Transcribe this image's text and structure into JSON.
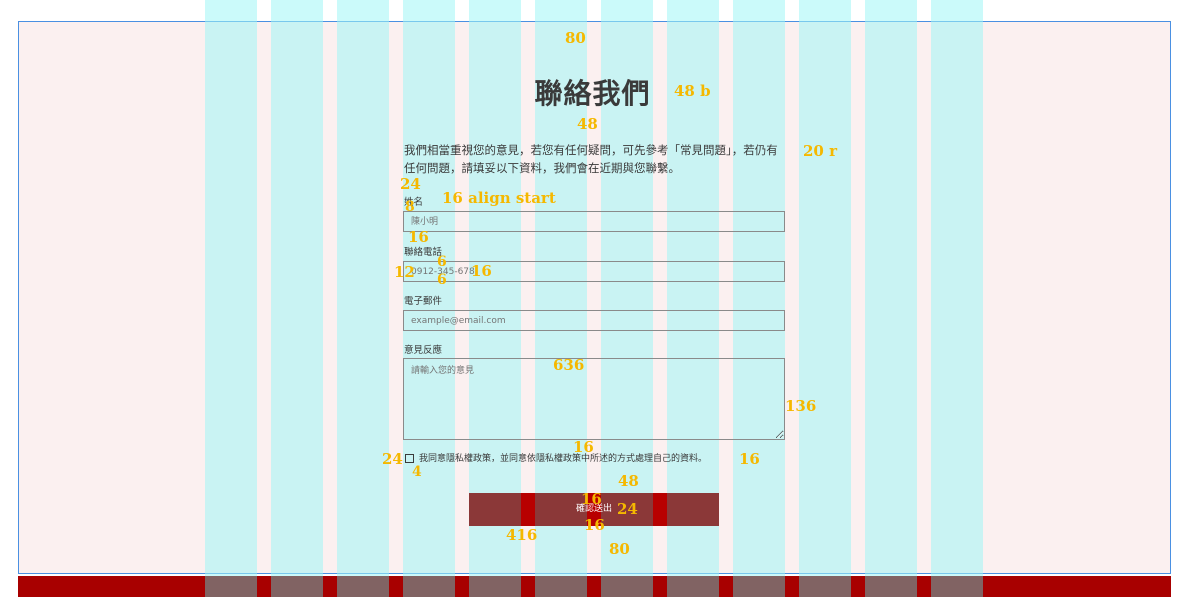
{
  "contact": {
    "title": "聯絡我們",
    "intro": "我們相當重視您的意見，若您有任何疑問，可先參考「常見問題」，若仍有任何問題，請填妥以下資料，我們會在近期與您聯繫。",
    "fields": {
      "name_label": "姓名",
      "name_placeholder": "陳小明",
      "phone_label": "聯絡電話",
      "phone_placeholder": "0912-345-678",
      "email_label": "電子郵件",
      "email_placeholder": "example@email.com",
      "feedback_label": "意見反應",
      "feedback_placeholder": "請輸入您的意見"
    },
    "privacy_text": "我同意隱私權政策，並同意依隱私權政策中所述的方式處理自己的資料。",
    "submit_label": "確認送出"
  },
  "annotations": {
    "top_padding": "80",
    "title_size": "48 b",
    "title_gap": "48",
    "intro_size": "20 r",
    "intro_gap": "24",
    "label_align": "16 align start",
    "label_gap": "8",
    "field_gap": "16",
    "input_pad_top": "6",
    "input_pad_bottom": "6",
    "input_pad_left": "12",
    "input_text": "16",
    "textarea_width": "636",
    "textarea_height": "136",
    "checkbox_size": "24",
    "checkbox_gap": "4",
    "checkbox_text_size": "16",
    "checkbox_top_gap": "16",
    "submit_gap": "48",
    "submit_pad_top": "16",
    "submit_text": "24",
    "submit_pad_bottom": "16",
    "submit_width": "416",
    "bottom_padding": "80"
  },
  "colors": {
    "frame_bg": "#fbf0f0",
    "frame_border": "#4a90e2",
    "grid_column": "#a0f5f5",
    "submit_bg": "#8b3838",
    "footer": "#a80000",
    "annotation": "#f5b800"
  }
}
